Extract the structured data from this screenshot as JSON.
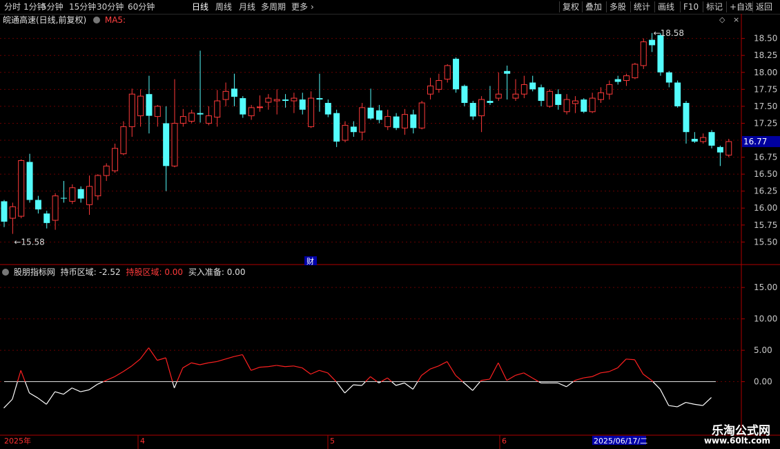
{
  "toolbar": {
    "left": [
      "分时",
      "1分钟",
      "5分钟",
      "15分钟",
      "30分钟",
      "60分钟",
      "日线",
      "周线",
      "月线",
      "多周期",
      "更多"
    ],
    "active": "日线",
    "right": [
      "复权",
      "叠加",
      "多股",
      "统计",
      "画线",
      "F10",
      "标记",
      "+自选",
      "返回"
    ]
  },
  "main_header": {
    "stock": "皖通高速(日线,前复权)",
    "ma_label": "MA5:"
  },
  "sub_header": {
    "name": "股朋指标网",
    "f1_label": "持币区域:",
    "f1_value": "-2.52",
    "f2_label": "持股区域:",
    "f2_value": "0.00",
    "f3_label": "买入准备:",
    "f3_value": "0.00"
  },
  "markers": {
    "high_label": "18.58",
    "low_label": "15.58",
    "finance_icon": "财"
  },
  "timeline": {
    "labels": [
      "2025年",
      "4",
      "5",
      "6"
    ],
    "cursor_date": "2025/06/17/二"
  },
  "price_tag": "16.77",
  "watermark": {
    "line1": "乐淘公式网",
    "line2": "www.60lt.com"
  },
  "colors": {
    "up": "#ff3a3a",
    "down": "#54fcfc",
    "grid": "#6a0000",
    "axis": "#b00000",
    "price_tag_bg": "#0000a0"
  },
  "chart_data": [
    {
      "type": "candlestick",
      "ylim": [
        15.3,
        18.7
      ],
      "yticks": [
        15.5,
        15.75,
        16.0,
        16.25,
        16.5,
        16.75,
        17.0,
        17.25,
        17.5,
        17.75,
        18.0,
        18.25,
        18.5
      ],
      "candles": [
        [
          16.1,
          15.8,
          16.12,
          15.72
        ],
        [
          15.85,
          16.02,
          16.08,
          15.62
        ],
        [
          15.88,
          16.7,
          16.72,
          15.85
        ],
        [
          16.68,
          16.12,
          16.8,
          16.08
        ],
        [
          16.12,
          15.98,
          16.18,
          15.92
        ],
        [
          15.92,
          15.78,
          15.96,
          15.7
        ],
        [
          15.82,
          16.18,
          16.22,
          15.68
        ],
        [
          16.15,
          16.14,
          16.4,
          16.08
        ],
        [
          16.1,
          16.3,
          16.35,
          16.06
        ],
        [
          16.28,
          16.14,
          16.32,
          16.08
        ],
        [
          16.05,
          16.32,
          16.48,
          15.9
        ],
        [
          16.18,
          16.48,
          16.5,
          16.12
        ],
        [
          16.48,
          16.62,
          16.66,
          16.4
        ],
        [
          16.55,
          16.88,
          16.95,
          16.52
        ],
        [
          16.8,
          17.2,
          17.28,
          16.78
        ],
        [
          17.2,
          17.68,
          17.76,
          17.05
        ],
        [
          17.36,
          17.65,
          17.75,
          17.2
        ],
        [
          17.68,
          17.36,
          17.95,
          17.1
        ],
        [
          17.35,
          17.5,
          17.52,
          17.2
        ],
        [
          17.25,
          16.62,
          17.5,
          16.25
        ],
        [
          16.62,
          17.25,
          17.9,
          16.6
        ],
        [
          17.25,
          17.35,
          17.46,
          17.2
        ],
        [
          17.28,
          17.4,
          17.45,
          17.25
        ],
        [
          17.4,
          17.38,
          18.32,
          17.26
        ],
        [
          17.25,
          17.36,
          17.5,
          17.22
        ],
        [
          17.34,
          17.58,
          17.74,
          17.2
        ],
        [
          17.6,
          17.72,
          17.85,
          17.5
        ],
        [
          17.76,
          17.64,
          17.98,
          17.5
        ],
        [
          17.62,
          17.38,
          17.65,
          17.33
        ],
        [
          17.36,
          17.48,
          17.52,
          17.3
        ],
        [
          17.48,
          17.49,
          17.66,
          17.42
        ],
        [
          17.56,
          17.62,
          17.68,
          17.45
        ],
        [
          17.58,
          17.6,
          17.75,
          17.38
        ],
        [
          17.6,
          17.58,
          17.68,
          17.48
        ],
        [
          17.58,
          17.62,
          17.7,
          17.4
        ],
        [
          17.6,
          17.45,
          17.7,
          17.38
        ],
        [
          17.2,
          17.62,
          17.72,
          17.18
        ],
        [
          17.62,
          17.6,
          17.98,
          17.42
        ],
        [
          17.55,
          17.38,
          17.6,
          17.34
        ],
        [
          17.4,
          16.98,
          17.45,
          16.9
        ],
        [
          17.0,
          17.22,
          17.28,
          16.97
        ],
        [
          17.2,
          17.12,
          17.28,
          17.05
        ],
        [
          17.12,
          17.48,
          17.55,
          17.0
        ],
        [
          17.48,
          17.32,
          17.76,
          17.3
        ],
        [
          17.44,
          17.3,
          17.52,
          17.25
        ],
        [
          17.2,
          17.35,
          17.45,
          17.15
        ],
        [
          17.35,
          17.18,
          17.4,
          17.15
        ],
        [
          17.18,
          17.38,
          17.46,
          17.08
        ],
        [
          17.38,
          17.18,
          17.45,
          17.1
        ],
        [
          17.18,
          17.55,
          17.58,
          17.16
        ],
        [
          17.68,
          17.8,
          17.92,
          17.6
        ],
        [
          17.75,
          17.88,
          17.98,
          17.7
        ],
        [
          17.9,
          18.1,
          18.12,
          17.85
        ],
        [
          18.2,
          17.75,
          18.22,
          17.7
        ],
        [
          17.8,
          17.55,
          17.82,
          17.5
        ],
        [
          17.55,
          17.35,
          17.58,
          17.3
        ],
        [
          17.36,
          17.6,
          17.65,
          17.12
        ],
        [
          17.58,
          17.55,
          17.8,
          17.52
        ],
        [
          17.62,
          17.68,
          18.0,
          17.58
        ],
        [
          18.02,
          17.98,
          18.1,
          17.6
        ],
        [
          17.62,
          17.68,
          17.9,
          17.58
        ],
        [
          17.68,
          17.82,
          17.95,
          17.62
        ],
        [
          17.85,
          17.75,
          17.95,
          17.72
        ],
        [
          17.78,
          17.58,
          17.82,
          17.5
        ],
        [
          17.5,
          17.72,
          17.75,
          17.48
        ],
        [
          17.68,
          17.52,
          17.75,
          17.45
        ],
        [
          17.42,
          17.6,
          17.68,
          17.38
        ],
        [
          17.54,
          17.58,
          17.65,
          17.4
        ],
        [
          17.6,
          17.42,
          17.62,
          17.4
        ],
        [
          17.42,
          17.62,
          17.7,
          17.4
        ],
        [
          17.6,
          17.7,
          17.78,
          17.55
        ],
        [
          17.68,
          17.82,
          17.88,
          17.6
        ],
        [
          17.9,
          17.86,
          17.95,
          17.82
        ],
        [
          17.88,
          17.95,
          17.98,
          17.8
        ],
        [
          17.92,
          18.12,
          18.14,
          17.9
        ],
        [
          18.1,
          18.45,
          18.5,
          18.05
        ],
        [
          18.48,
          18.4,
          18.58,
          18.3
        ],
        [
          18.55,
          18.0,
          18.58,
          17.95
        ],
        [
          18.0,
          17.85,
          18.02,
          17.78
        ],
        [
          17.85,
          17.5,
          17.88,
          17.48
        ],
        [
          17.55,
          17.12,
          17.58,
          16.95
        ],
        [
          17.02,
          16.98,
          17.12,
          16.96
        ],
        [
          16.98,
          17.04,
          17.1,
          16.95
        ],
        [
          17.12,
          16.92,
          17.15,
          16.88
        ],
        [
          16.9,
          16.82,
          16.92,
          16.62
        ],
        [
          16.78,
          16.98,
          17.02,
          16.75
        ]
      ]
    },
    {
      "type": "line",
      "ylim": [
        -5,
        17
      ],
      "yticks": [
        0.0,
        5.0,
        10.0,
        15.0
      ],
      "baseline": 0,
      "series": [
        {
          "name": "持币区域",
          "values": [
            -4.2,
            -2.8,
            1.8,
            -1.8,
            -2.6,
            -3.6,
            -1.6,
            -2.0,
            -1.0,
            -1.6,
            -1.3,
            -0.4,
            0.2,
            0.8,
            1.6,
            2.5,
            3.6,
            5.4,
            3.4,
            3.8,
            -1.0,
            2.2,
            3.0,
            2.7,
            3.0,
            3.2,
            3.6,
            4.0,
            4.3,
            1.8,
            2.3,
            2.4,
            2.6,
            2.4,
            2.5,
            2.2,
            1.2,
            1.8,
            1.4,
            0.0,
            -1.8,
            -0.5,
            -0.6,
            0.8,
            -0.2,
            0.6,
            -0.6,
            -0.2,
            -1.2,
            1.0,
            2.0,
            2.5,
            3.2,
            1.0,
            -0.2,
            -1.4,
            0.2,
            0.4,
            3.0,
            0.2,
            1.0,
            1.4,
            0.6,
            -0.2,
            -0.2,
            -0.2,
            -0.8,
            0.2,
            0.6,
            0.8,
            1.4,
            1.6,
            2.2,
            3.6,
            3.5,
            1.2,
            0.2,
            -1.2,
            -3.8,
            -4.0,
            -3.3,
            -3.6,
            -3.8,
            -2.52
          ]
        }
      ]
    }
  ]
}
